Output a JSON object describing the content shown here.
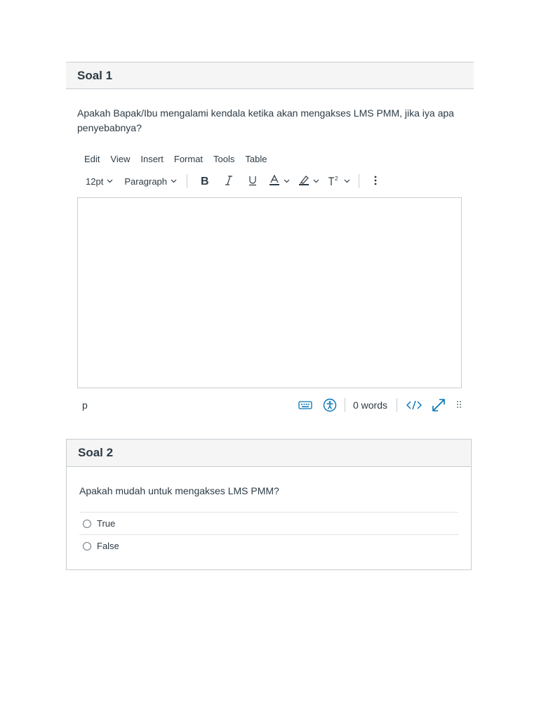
{
  "question1": {
    "title": "Soal 1",
    "text": "Apakah Bapak/Ibu mengalami kendala ketika akan mengakses LMS PMM, jika iya apa penyebabnya?",
    "menu": [
      "Edit",
      "View",
      "Insert",
      "Format",
      "Tools",
      "Table"
    ],
    "toolbar": {
      "font_size": "12pt",
      "block_format": "Paragraph"
    },
    "status": {
      "path": "p",
      "word_count": "0 words"
    }
  },
  "question2": {
    "title": "Soal 2",
    "text": "Apakah mudah untuk mengakses LMS PMM?",
    "answers": [
      "True",
      "False"
    ]
  },
  "colors": {
    "text": "#2d3b45",
    "header_bg": "#f5f5f5",
    "border": "#c7cdd1",
    "accent": "#0374b5"
  }
}
